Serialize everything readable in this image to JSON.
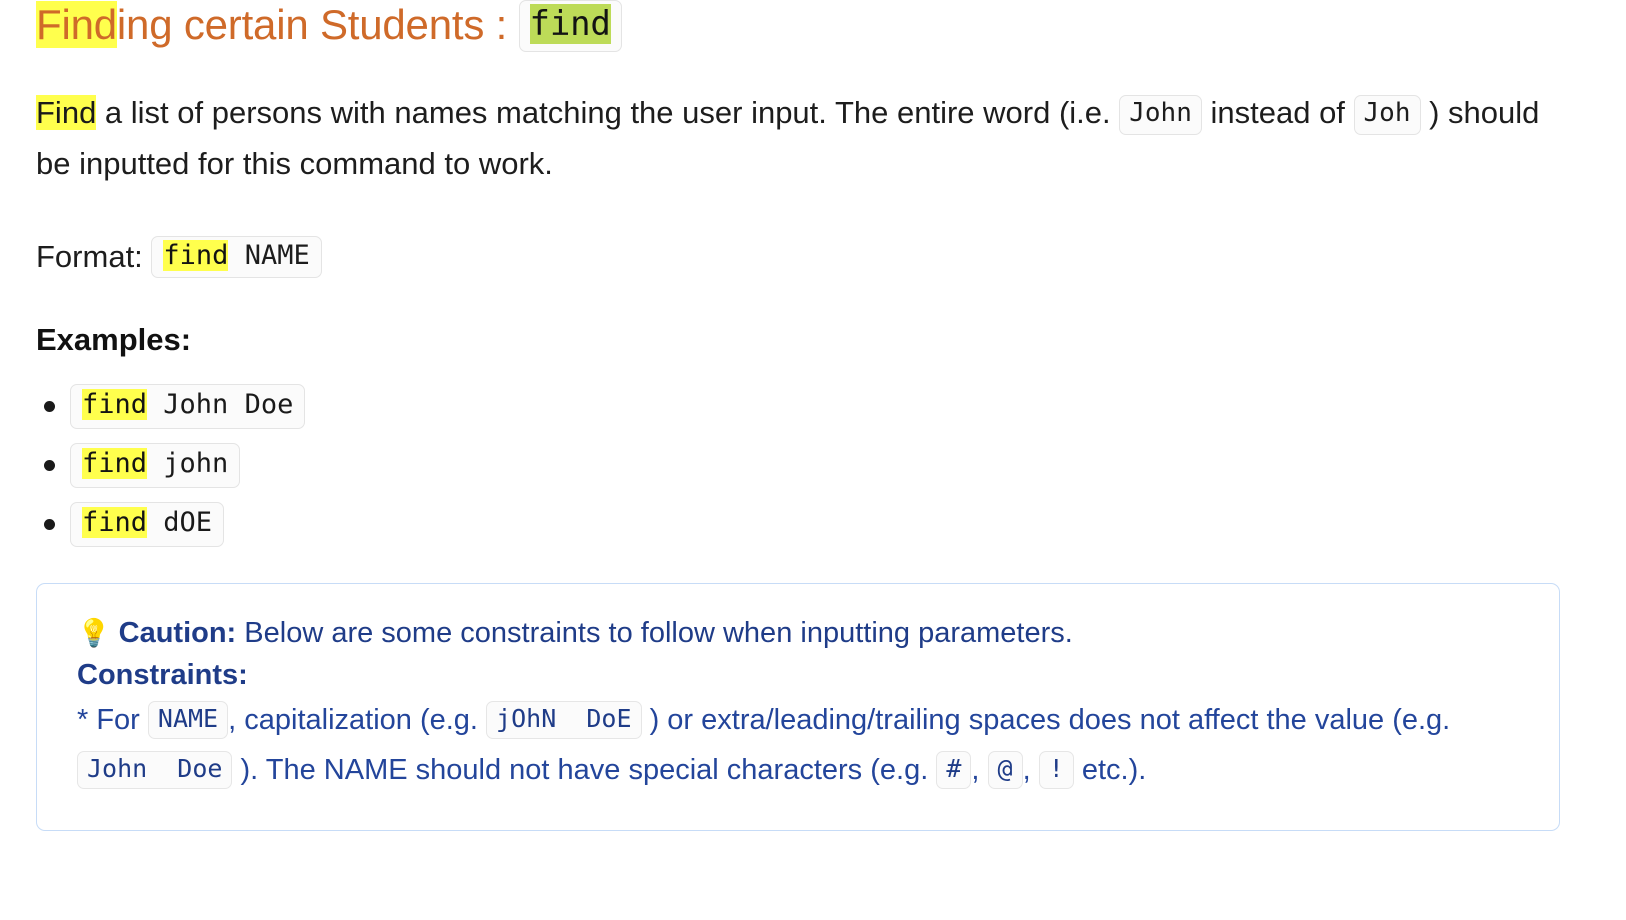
{
  "heading": {
    "highlight": "Find",
    "rest": "ing certain Students : ",
    "code": "find"
  },
  "intro": {
    "lead_highlight": "Find",
    "text_1": " a list of persons with names matching the user input. The entire word (i.e. ",
    "chip_john": "John",
    "text_2": " instead of ",
    "chip_joh": "Joh",
    "text_3": " ) should be inputted for this command to work."
  },
  "format": {
    "label": "Format: ",
    "command": "find",
    "argument": " NAME"
  },
  "examples": {
    "heading": "Examples:",
    "items": [
      {
        "command": "find",
        "argument": " John Doe"
      },
      {
        "command": "find",
        "argument": " john"
      },
      {
        "command": "find",
        "argument": " dOE"
      }
    ]
  },
  "callout": {
    "icon": "light-bulb",
    "icon_glyph": "💡",
    "title": "Caution:",
    "intro": " Below are some constraints to follow when inputting parameters.",
    "subtitle": "Constraints:",
    "body_1": "* For ",
    "chip_name": "NAME",
    "body_2": ", capitalization (e.g. ",
    "chip_johndoe_mixed": "jOhN  DoE",
    "body_3": " ) or extra/leading/trailing spaces does not affect the value (e.g. ",
    "chip_johndoe": "John  Doe",
    "body_4": " ). The NAME should not have special characters (e.g. ",
    "chip_hash": "#",
    "sep_1": ", ",
    "chip_at": "@",
    "sep_2": ", ",
    "chip_bang": "!",
    "body_5": " etc.)."
  },
  "colors": {
    "heading": "#cf6a29",
    "highlight_yellow": "#ffff4d",
    "heading_chip_highlight": "#bddb58",
    "callout_text": "#1f3c88",
    "callout_border": "#c7dcf7"
  }
}
